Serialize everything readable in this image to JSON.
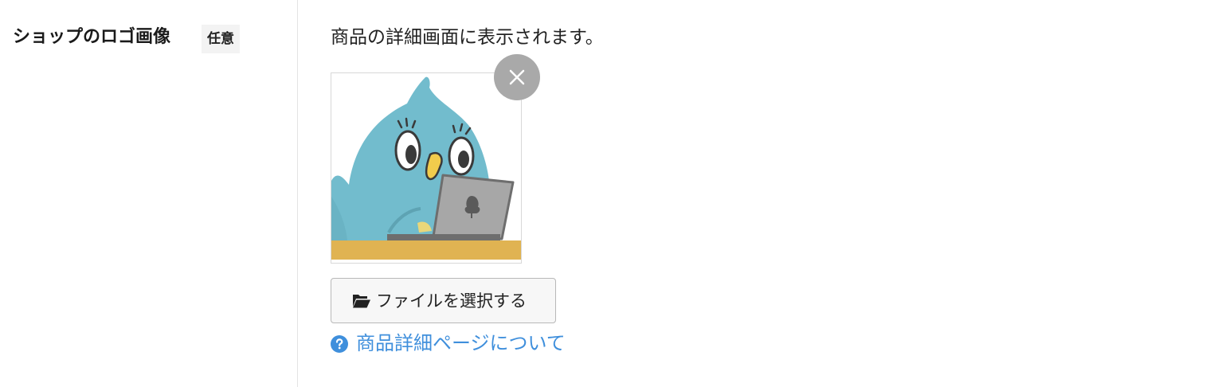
{
  "field": {
    "title": "ショップのロゴ画像",
    "badge": "任意"
  },
  "content": {
    "description": "商品の詳細画面に表示されます。",
    "image": {
      "alt": "ロゴ画像",
      "icon": "bird-with-laptop-illustration"
    },
    "remove_icon": "close-icon",
    "file_button_label": "ファイルを選択する",
    "file_button_icon": "folder-open-icon",
    "help_link_label": "商品詳細ページについて",
    "help_icon": "question-circle-icon"
  },
  "colors": {
    "link": "#3f8fdc",
    "remove_button": "#a9a9a9",
    "badge_bg": "#f3f3f3",
    "bird": "#72bccd",
    "desk": "#e0b352",
    "laptop": "#a7a7a7"
  }
}
